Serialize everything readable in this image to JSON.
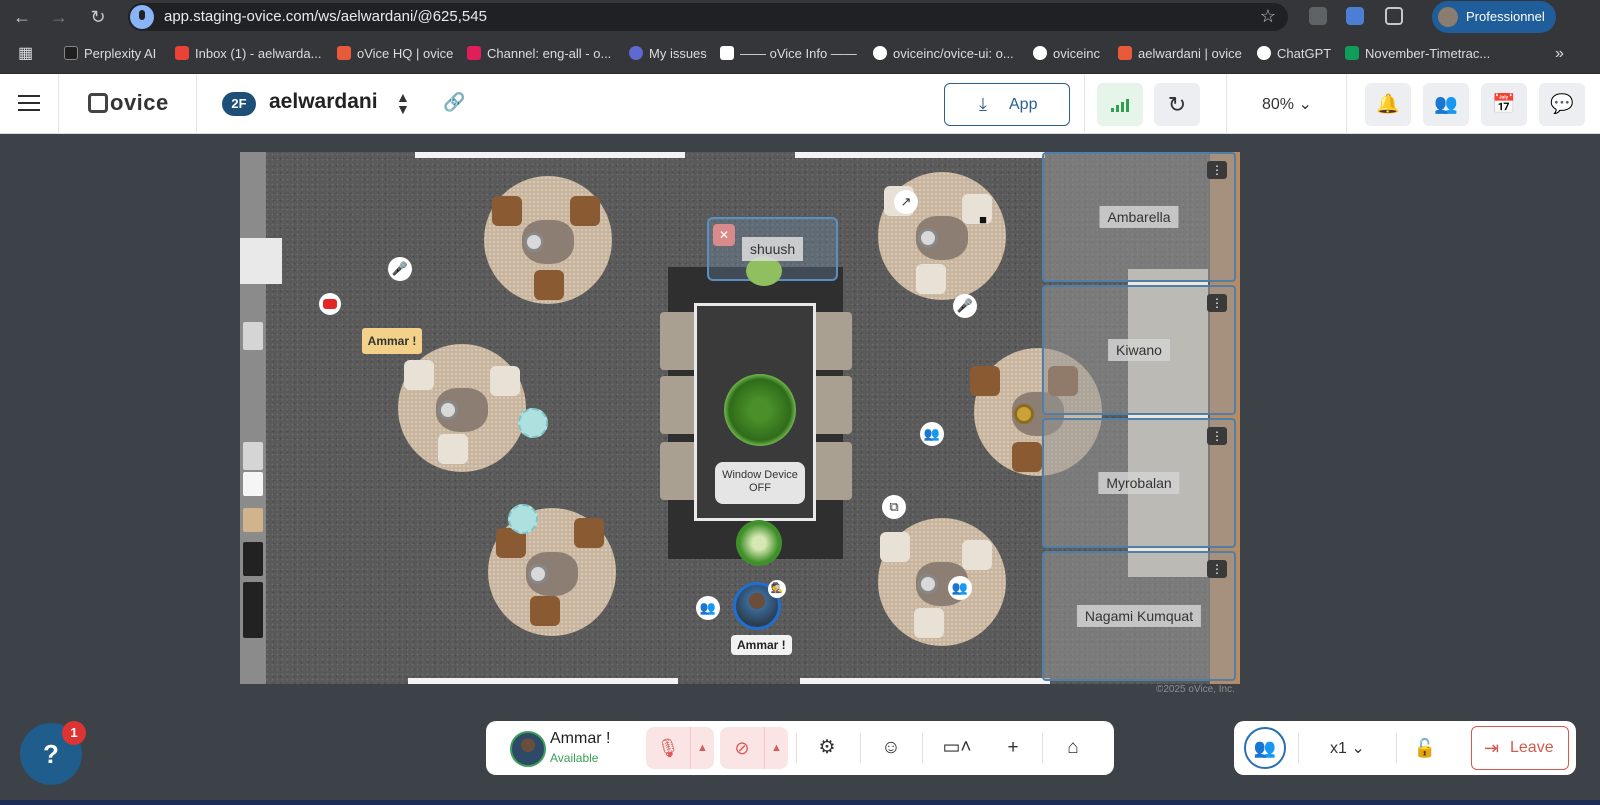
{
  "browser": {
    "url": "app.staging-ovice.com/ws/aelwardani/@625,545",
    "profile_label": "Professionnel",
    "bookmarks": [
      {
        "label": "Perplexity AI",
        "color": "#1f1f1f"
      },
      {
        "label": "Inbox (1) - aelwarda...",
        "color": "#ea4335"
      },
      {
        "label": "oVice HQ | ovice",
        "color": "#e85a3a"
      },
      {
        "label": "Channel: eng-all - o...",
        "color": "#e01e5a"
      },
      {
        "label": "My issues",
        "color": "#5e6ad2"
      },
      {
        "label": "—— oVice Info ——",
        "color": "#ffffff"
      },
      {
        "label": "oviceinc/ovice-ui: o...",
        "color": "#ffffff"
      },
      {
        "label": "oviceinc",
        "color": "#ffffff"
      },
      {
        "label": "aelwardani | ovice",
        "color": "#e85a3a"
      },
      {
        "label": "ChatGPT",
        "color": "#ffffff"
      },
      {
        "label": "November-Timetrac...",
        "color": "#0f9d58"
      }
    ],
    "more_bookmarks": "»"
  },
  "header": {
    "logo_text": "ovice",
    "floor_badge": "2F",
    "space_name": "aelwardani",
    "app_button_label": "App",
    "zoom_level": "80%"
  },
  "map": {
    "rooms": [
      {
        "name": "Ambarella"
      },
      {
        "name": "Kiwano"
      },
      {
        "name": "Myrobalan"
      },
      {
        "name": "Nagami Kumquat"
      }
    ],
    "shuush_label": "shuush",
    "window_device_line1": "Window Device",
    "window_device_line2": "OFF",
    "user_chip_name": "Ammar !",
    "my_avatar_name": "Ammar !",
    "copyright": "©2025 oVice, Inc."
  },
  "controls": {
    "user_name": "Ammar !",
    "user_status": "Available",
    "speed_label": "x1",
    "leave_label": "Leave",
    "help_badge_count": "1"
  },
  "colors": {
    "accent": "#1e5d8c",
    "mute_bg": "#fbe4e4",
    "available": "#3aa057",
    "leave": "#d65a4a"
  }
}
